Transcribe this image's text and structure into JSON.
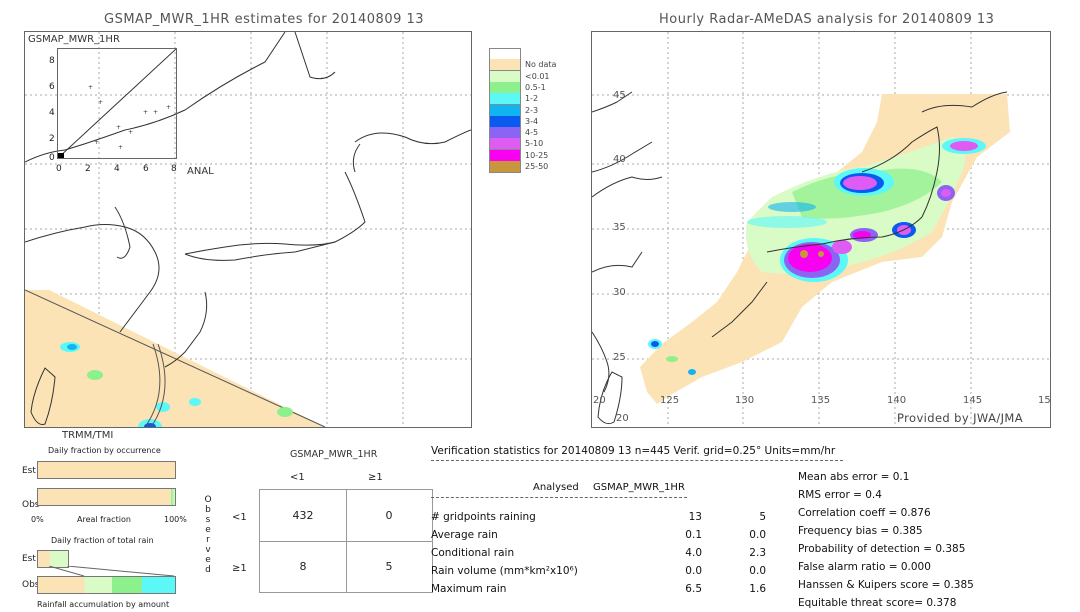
{
  "left_panel": {
    "title": "GSMAP_MWR_1HR estimates for 20140809 13",
    "inset_label": "GSMAP_MWR_1HR",
    "inset_y_ticks": [
      "8",
      "6",
      "4",
      "2",
      "0"
    ],
    "inset_x_ticks": [
      "0",
      "2",
      "4",
      "6",
      "8"
    ],
    "inset_x_axis_label": "ANAL",
    "sensor_label": "TRMM/TMI"
  },
  "right_panel": {
    "title": "Hourly Radar-AMeDAS analysis for 20140809 13",
    "lat_ticks": [
      "45",
      "40",
      "35",
      "30",
      "25",
      "20"
    ],
    "lon_ticks": [
      "125",
      "130",
      "135",
      "140",
      "145",
      "15"
    ],
    "corner_label": "20",
    "credit": "Provided by JWA/JMA"
  },
  "legend": {
    "items": [
      {
        "label": "",
        "color": "#ffffff"
      },
      {
        "label": "No data",
        "color": "#fbe3b6"
      },
      {
        "label": "<0.01",
        "color": "#d9fbc6"
      },
      {
        "label": "0.5-1",
        "color": "#8cf08c"
      },
      {
        "label": "1-2",
        "color": "#5cf8f8"
      },
      {
        "label": "2-3",
        "color": "#10b4f0"
      },
      {
        "label": "3-4",
        "color": "#0a5af0"
      },
      {
        "label": "4-5",
        "color": "#8c64f4"
      },
      {
        "label": "5-10",
        "color": "#de5cf4"
      },
      {
        "label": "10-25",
        "color": "#f800f0"
      },
      {
        "label": "25-50",
        "color": "#c8963c"
      }
    ]
  },
  "occurrence": {
    "title": "Daily fraction by occurrence",
    "est_label": "Est",
    "obs_label": "Obs",
    "axis_left": "0%",
    "axis_mid": "Areal fraction",
    "axis_right": "100%"
  },
  "total_rain": {
    "title": "Daily fraction of total rain",
    "est_label": "Est",
    "obs_label": "Obs",
    "caption": "Rainfall accumulation by amount"
  },
  "contingency": {
    "product": "GSMAP_MWR_1HR",
    "col_headers": [
      "<1",
      "≥1"
    ],
    "row_headers": [
      "<1",
      "≥1"
    ],
    "observed_label": [
      "O",
      "b",
      "s",
      "e",
      "r",
      "v",
      "e",
      "d"
    ],
    "cells": [
      [
        "432",
        "0"
      ],
      [
        "8",
        "5"
      ]
    ]
  },
  "verification": {
    "header": "Verification statistics for 20140809 13   n=445   Verif. grid=0.25°   Units=mm/hr",
    "col_analysed": "Analysed",
    "col_product": "GSMAP_MWR_1HR",
    "rows": [
      {
        "label": "# gridpoints raining",
        "analysed": "13",
        "product": "5"
      },
      {
        "label": "Average rain",
        "analysed": "0.1",
        "product": "0.0"
      },
      {
        "label": "Conditional rain",
        "analysed": "4.0",
        "product": "2.3"
      },
      {
        "label": "Rain volume (mm*km²x10⁶)",
        "analysed": "0.0",
        "product": "0.0"
      },
      {
        "label": "Maximum rain",
        "analysed": "6.5",
        "product": "1.6"
      }
    ],
    "scores": [
      "Mean abs error = 0.1",
      "RMS error = 0.4",
      "Correlation coeff = 0.876",
      "Frequency bias = 0.385",
      "Probability of detection = 0.385",
      "False alarm ratio = 0.000",
      "Hanssen & Kuipers score = 0.385",
      "Equitable threat score= 0.378"
    ]
  }
}
